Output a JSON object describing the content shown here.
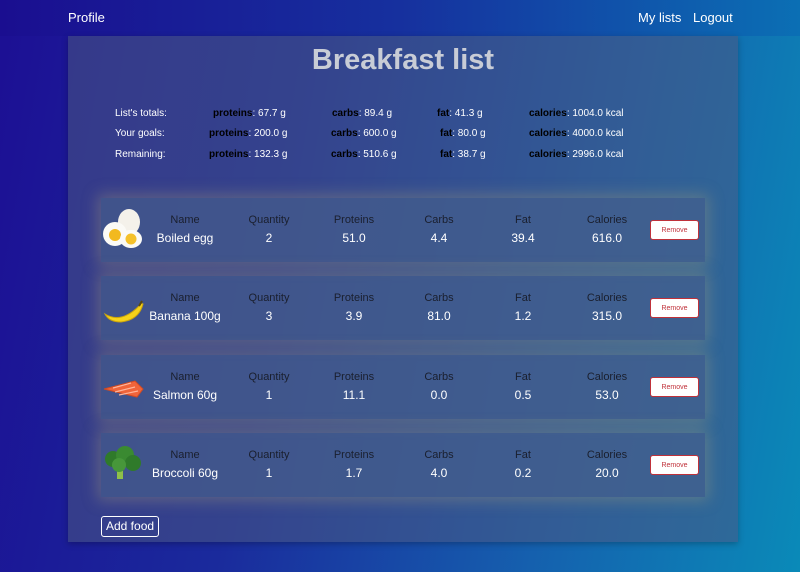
{
  "nav": {
    "profile": "Profile",
    "my_lists": "My lists",
    "logout": "Logout"
  },
  "list": {
    "title": "Breakfast list"
  },
  "totals": {
    "rows": [
      {
        "label": "List's totals:",
        "proteins": "67.7 g",
        "carbs": "89.4 g",
        "fat": "41.3 g",
        "calories": "1004.0 kcal"
      },
      {
        "label": "Your goals:",
        "proteins": "200.0 g",
        "carbs": "600.0 g",
        "fat": "80.0 g",
        "calories": "4000.0 kcal"
      },
      {
        "label": "Remaining:",
        "proteins": "132.3 g",
        "carbs": "510.6 g",
        "fat": "38.7 g",
        "calories": "2996.0 kcal"
      }
    ],
    "keys": {
      "proteins": "proteins",
      "carbs": "carbs",
      "fat": "fat",
      "calories": "calories"
    }
  },
  "columns": {
    "name": "Name",
    "quantity": "Quantity",
    "proteins": "Proteins",
    "carbs": "Carbs",
    "fat": "Fat",
    "calories": "Calories"
  },
  "foods": [
    {
      "name": "Boiled egg",
      "quantity": "2",
      "proteins": "51.0",
      "carbs": "4.4",
      "fat": "39.4",
      "calories": "616.0",
      "icon": "boiled-egg-icon"
    },
    {
      "name": "Banana 100g",
      "quantity": "3",
      "proteins": "3.9",
      "carbs": "81.0",
      "fat": "1.2",
      "calories": "315.0",
      "icon": "banana-icon"
    },
    {
      "name": "Salmon 60g",
      "quantity": "1",
      "proteins": "11.1",
      "carbs": "0.0",
      "fat": "0.5",
      "calories": "53.0",
      "icon": "salmon-icon"
    },
    {
      "name": "Broccoli 60g",
      "quantity": "1",
      "proteins": "1.7",
      "carbs": "4.0",
      "fat": "0.2",
      "calories": "20.0",
      "icon": "broccoli-icon"
    }
  ],
  "actions": {
    "remove": "Remove",
    "add_food": "Add food"
  },
  "colors": {
    "remove_border": "#c0313a",
    "title": "#c8ccd6"
  }
}
